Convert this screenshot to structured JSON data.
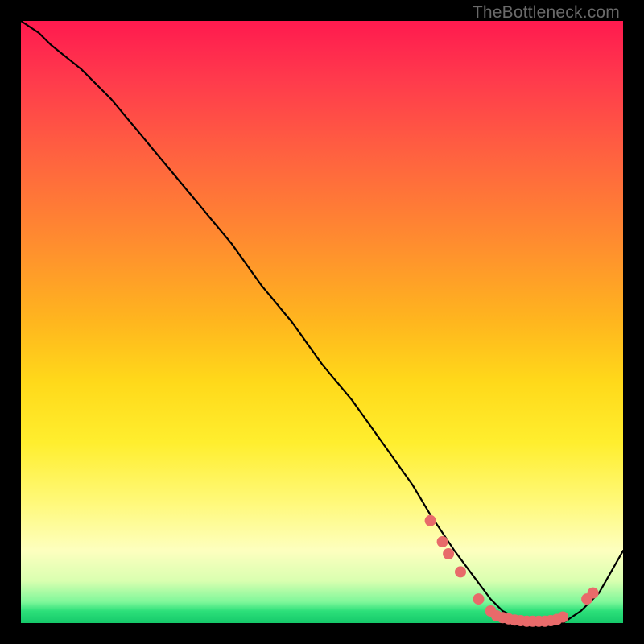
{
  "attribution": "TheBottleneck.com",
  "chart_data": {
    "type": "line",
    "title": "",
    "xlabel": "",
    "ylabel": "",
    "xlim": [
      0,
      100
    ],
    "ylim": [
      0,
      100
    ],
    "series": [
      {
        "name": "curve",
        "x": [
          0,
          3,
          5,
          10,
          15,
          20,
          25,
          30,
          35,
          40,
          45,
          50,
          55,
          60,
          65,
          68,
          72,
          75,
          78,
          80,
          82,
          84,
          86,
          88,
          90,
          93,
          96,
          100
        ],
        "values": [
          100,
          98,
          96,
          92,
          87,
          81,
          75,
          69,
          63,
          56,
          50,
          43,
          37,
          30,
          23,
          18,
          12,
          8,
          4,
          2,
          1,
          0,
          0,
          0,
          0,
          2,
          5,
          12
        ]
      }
    ],
    "markers": {
      "name": "highlight-dots",
      "color": "#e86a6a",
      "points": [
        {
          "x": 68,
          "y": 17
        },
        {
          "x": 70,
          "y": 13.5
        },
        {
          "x": 71,
          "y": 11.5
        },
        {
          "x": 73,
          "y": 8.5
        },
        {
          "x": 76,
          "y": 4
        },
        {
          "x": 78,
          "y": 2
        },
        {
          "x": 79,
          "y": 1.2
        },
        {
          "x": 80,
          "y": 0.9
        },
        {
          "x": 81,
          "y": 0.7
        },
        {
          "x": 82,
          "y": 0.5
        },
        {
          "x": 83,
          "y": 0.4
        },
        {
          "x": 84,
          "y": 0.3
        },
        {
          "x": 85,
          "y": 0.3
        },
        {
          "x": 86,
          "y": 0.3
        },
        {
          "x": 87,
          "y": 0.3
        },
        {
          "x": 88,
          "y": 0.4
        },
        {
          "x": 89,
          "y": 0.6
        },
        {
          "x": 90,
          "y": 1.0
        },
        {
          "x": 94,
          "y": 4
        },
        {
          "x": 95,
          "y": 5
        }
      ]
    },
    "gradient_stops": [
      {
        "pos": 0,
        "color": "#ff1a4f"
      },
      {
        "pos": 0.36,
        "color": "#ff8a30"
      },
      {
        "pos": 0.7,
        "color": "#ffee2e"
      },
      {
        "pos": 0.93,
        "color": "#d9ffb0"
      },
      {
        "pos": 1.0,
        "color": "#15c96a"
      }
    ]
  }
}
